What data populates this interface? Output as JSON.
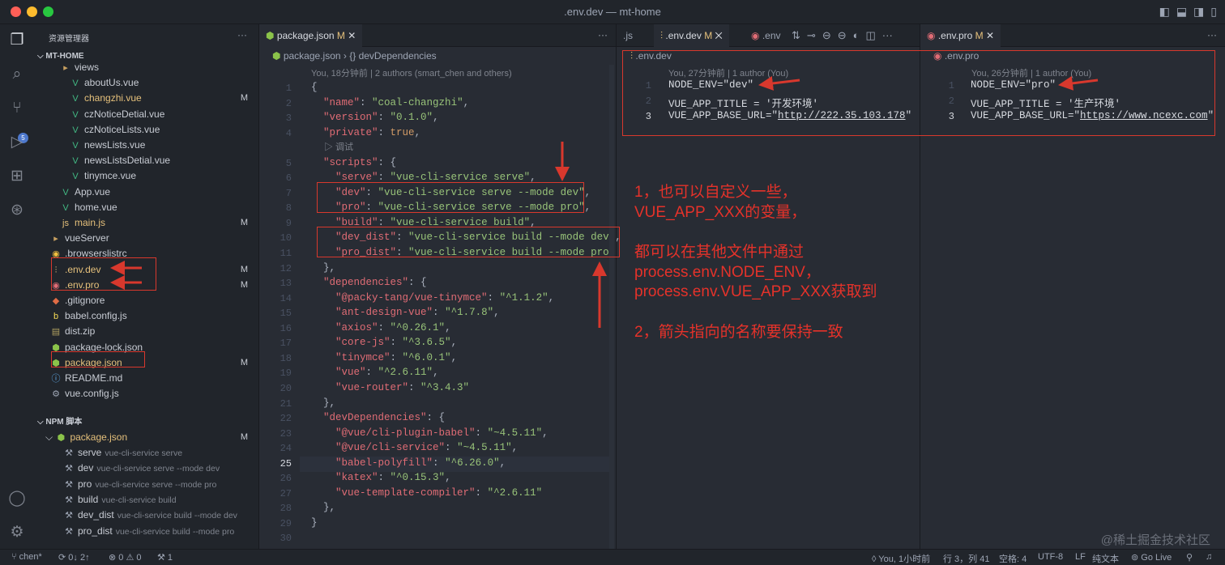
{
  "window": {
    "title": ".env.dev — mt-home"
  },
  "sidebar": {
    "header": "资源管理器",
    "more": "···",
    "project": "MT-HOME",
    "items": [
      {
        "label": "views",
        "icon": "folder-icon",
        "indent": 2,
        "mod": false,
        "m": ""
      },
      {
        "label": "aboutUs.vue",
        "icon": "vue-icon",
        "indent": 3,
        "mod": false,
        "m": ""
      },
      {
        "label": "changzhi.vue",
        "icon": "vue-icon",
        "indent": 3,
        "mod": true,
        "m": "M"
      },
      {
        "label": "czNoticeDetial.vue",
        "icon": "vue-icon",
        "indent": 3,
        "mod": false,
        "m": ""
      },
      {
        "label": "czNoticeLists.vue",
        "icon": "vue-icon",
        "indent": 3,
        "mod": false,
        "m": ""
      },
      {
        "label": "newsLists.vue",
        "icon": "vue-icon",
        "indent": 3,
        "mod": false,
        "m": ""
      },
      {
        "label": "newsListsDetial.vue",
        "icon": "vue-icon",
        "indent": 3,
        "mod": false,
        "m": ""
      },
      {
        "label": "tinymce.vue",
        "icon": "vue-icon",
        "indent": 3,
        "mod": false,
        "m": ""
      },
      {
        "label": "App.vue",
        "icon": "vue-icon",
        "indent": 2,
        "mod": false,
        "m": ""
      },
      {
        "label": "home.vue",
        "icon": "vue-icon",
        "indent": 2,
        "mod": false,
        "m": ""
      },
      {
        "label": "main.js",
        "icon": "js-icon",
        "indent": 2,
        "mod": true,
        "m": "M"
      },
      {
        "label": "vueServer",
        "icon": "folder-icon",
        "indent": 1,
        "mod": false,
        "m": ""
      },
      {
        "label": ".browserslistrc",
        "icon": "browserslist-icon",
        "indent": 1,
        "mod": false,
        "m": ""
      },
      {
        "label": ".env.dev",
        "icon": "env-settings-icon",
        "indent": 1,
        "mod": true,
        "m": "M"
      },
      {
        "label": ".env.pro",
        "icon": "env-cat-icon",
        "indent": 1,
        "mod": true,
        "m": "M"
      },
      {
        "label": ".gitignore",
        "icon": "git-icon",
        "indent": 1,
        "mod": false,
        "m": ""
      },
      {
        "label": "babel.config.js",
        "icon": "babel-icon",
        "indent": 1,
        "mod": false,
        "m": ""
      },
      {
        "label": "dist.zip",
        "icon": "zip-icon",
        "indent": 1,
        "mod": false,
        "m": ""
      },
      {
        "label": "package-lock.json",
        "icon": "npm-icon",
        "indent": 1,
        "mod": false,
        "m": ""
      },
      {
        "label": "package.json",
        "icon": "npm-icon",
        "indent": 1,
        "mod": true,
        "m": "M"
      },
      {
        "label": "README.md",
        "icon": "info-icon",
        "indent": 1,
        "mod": false,
        "m": ""
      },
      {
        "label": "vue.config.js",
        "icon": "config-icon",
        "indent": 1,
        "mod": false,
        "m": ""
      }
    ],
    "npm": {
      "header": "NPM 脚本",
      "file": "package.json",
      "m": "M",
      "scripts": [
        {
          "name": "serve",
          "cmd": "vue-cli-service serve"
        },
        {
          "name": "dev",
          "cmd": "vue-cli-service serve --mode dev"
        },
        {
          "name": "pro",
          "cmd": "vue-cli-service serve --mode pro"
        },
        {
          "name": "build",
          "cmd": "vue-cli-service build"
        },
        {
          "name": "dev_dist",
          "cmd": "vue-cli-service build --mode dev"
        },
        {
          "name": "pro_dist",
          "cmd": "vue-cli-service build --mode pro"
        }
      ]
    }
  },
  "editor1": {
    "tab": "package.json",
    "tab_m": "M",
    "more": "···",
    "breadcrumb": [
      "package.json",
      "{} devDependencies"
    ],
    "blame": "You, 18分钟前 | 2 authors (smart_chen and others)",
    "codelens": "▷ 调试",
    "current_line": 25,
    "lines": [
      "{",
      "  \"name\": \"coal-changzhi\",",
      "  \"version\": \"0.1.0\",",
      "  \"private\": true,",
      "  \"scripts\": {",
      "    \"serve\": \"vue-cli-service serve\",",
      "    \"dev\": \"vue-cli-service serve --mode dev\",",
      "    \"pro\": \"vue-cli-service serve --mode pro\",",
      "    \"build\": \"vue-cli-service build\",",
      "    \"dev_dist\": \"vue-cli-service build --mode dev\",",
      "    \"pro_dist\": \"vue-cli-service build --mode pro\"",
      "  },",
      "  \"dependencies\": {",
      "    \"@packy-tang/vue-tinymce\": \"^1.1.2\",",
      "    \"ant-design-vue\": \"^1.7.8\",",
      "    \"axios\": \"^0.26.1\",",
      "    \"core-js\": \"^3.6.5\",",
      "    \"tinymce\": \"^6.0.1\",",
      "    \"vue\": \"^2.6.11\",",
      "    \"vue-router\": \"^3.4.3\"",
      "  },",
      "  \"devDependencies\": {",
      "    \"@vue/cli-plugin-babel\": \"~4.5.11\",",
      "    \"@vue/cli-service\": \"~4.5.11\",",
      "    \"babel-polyfill\": \"^6.26.0\",",
      "    \"katex\": \"^0.15.3\",",
      "    \"vue-template-compiler\": \"^2.6.11\"",
      "  },",
      "}",
      ""
    ]
  },
  "editor2": {
    "tab_prev": ".js",
    "tab": ".env.dev",
    "tab_m": "M",
    "tab2": ".env",
    "more": "···",
    "header": ".env.dev",
    "blame": "You, 27分钟前 | 1 author (You)",
    "lines": [
      "NODE_ENV=\"dev\"",
      "VUE_APP_TITLE = '开发环境'",
      "VUE_APP_BASE_URL=\"http://222.35.103.178\""
    ]
  },
  "editor3": {
    "tab": ".env.pro",
    "tab_m": "M",
    "more": "···",
    "header": ".env.pro",
    "blame": "You, 26分钟前 | 1 author (You)",
    "lines": [
      "NODE_ENV=\"pro\"",
      "VUE_APP_TITLE = '生产环境'",
      "VUE_APP_BASE_URL=\"https://www.ncexc.com\""
    ]
  },
  "annotation": {
    "lines": [
      "1，也可以自定义一些，",
      "VUE_APP_XXX的变量，",
      "",
      "都可以在其他文件中通过",
      "process.env.NODE_ENV，",
      "process.env.VUE_APP_XXX获取到",
      "",
      "2，箭头指向的名称要保持一致"
    ],
    "color": "#e5322a"
  },
  "statusbar": {
    "branch": "chen*",
    "sync": "0↓ 2↑",
    "problems": "⊗ 0 ⚠ 0",
    "ports": "1",
    "blame": "You, 1小时前",
    "position": "行 3，列 41",
    "spaces": "空格: 4",
    "encoding": "UTF-8",
    "eol": "LF",
    "language": "纯文本",
    "golive": "Go Live"
  },
  "watermark": "@稀土掘金技术社区"
}
